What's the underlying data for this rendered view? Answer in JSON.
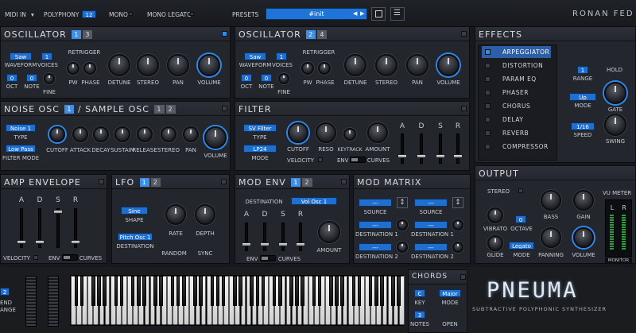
{
  "topbar": {
    "midi_in": "MIDI IN",
    "polyphony_label": "POLYPHONY",
    "polyphony_value": "12",
    "mono": "MONO",
    "mono_legato": "MONO LEGATO",
    "presets_label": "PRESETS",
    "preset_name": "#init",
    "brand": "RONAN FED"
  },
  "osc1": {
    "title": "OSCILLATOR",
    "tab_a": "1",
    "tab_b": "3",
    "waveform_value": "Saw",
    "waveform": "WAVEFORM",
    "voices_value": "1",
    "voices": "VOICES",
    "oct_value": "0",
    "oct": "OCT",
    "note_value": "0",
    "note": "NOTE",
    "fine": "FINE",
    "retrigger": "RETRIGGER",
    "pw": "PW",
    "phase": "PHASE",
    "detune": "DETUNE",
    "stereo": "STEREO",
    "pan": "PAN",
    "volume": "VOLUME"
  },
  "osc2": {
    "title": "OSCILLATOR",
    "tab_a": "2",
    "tab_b": "4",
    "waveform_value": "Saw",
    "waveform": "WAVEFORM",
    "voices_value": "1",
    "voices": "VOICES",
    "oct_value": "0",
    "oct": "OCT",
    "note_value": "0",
    "note": "NOTE",
    "fine": "FINE",
    "retrigger": "RETRIGGER",
    "pw": "PW",
    "phase": "PHASE",
    "detune": "DETUNE",
    "stereo": "STEREO",
    "pan": "PAN",
    "volume": "VOLUME"
  },
  "noise": {
    "title_a": "NOISE OSC",
    "tab_a": "1",
    "title_b": "/ SAMPLE OSC",
    "tab_b1": "1",
    "tab_b2": "2",
    "type_value": "Noise 1",
    "type": "TYPE",
    "filter_value": "Low Pass",
    "filter_mode": "FILTER MODE",
    "cutoff": "CUTOFF",
    "attack": "ATTACK",
    "decay": "DECAY",
    "sustain": "SUSTAIN",
    "release": "RELEASE",
    "stereo": "STEREO",
    "pan": "PAN",
    "volume": "VOLUME"
  },
  "filter": {
    "title": "FILTER",
    "type_value": "SV Filter",
    "type": "TYPE",
    "mode_value": "LP24",
    "mode": "MODE",
    "cutoff": "CUTOFF",
    "reso": "RESO",
    "keytrack": "KEYTRACK",
    "amount": "AMOUNT",
    "velocity": "VELOCITY",
    "env": "ENV",
    "curves": "CURVES",
    "adsr": [
      "A",
      "D",
      "S",
      "R"
    ]
  },
  "effects": {
    "title": "EFFECTS",
    "items": [
      "ARPEGGIATOR",
      "DISTORTION",
      "PARAM EQ",
      "PHASER",
      "CHORUS",
      "DELAY",
      "REVERB",
      "COMPRESSOR"
    ],
    "range_value": "1",
    "range": "RANGE",
    "hold": "HOLD",
    "mode_value": "Up",
    "mode": "MODE",
    "gate": "GATE",
    "speed_value": "1/16",
    "speed": "SPEED",
    "swing": "SWING"
  },
  "ampenv": {
    "title": "AMP ENVELOPE",
    "adsr": [
      "A",
      "D",
      "S",
      "R"
    ],
    "velocity": "VELOCITY",
    "env": "ENV",
    "curves": "CURVES"
  },
  "lfo": {
    "title": "LFO",
    "tab_a": "1",
    "tab_b": "2",
    "shape_value": "Sine",
    "shape": "SHAPE",
    "dest_value": "Pitch Osc 1",
    "destination": "DESTINATION",
    "rate": "RATE",
    "depth": "DEPTH",
    "random": "RANDOM",
    "sync": "SYNC"
  },
  "modenv": {
    "title": "MOD ENV",
    "tab_a": "1",
    "tab_b": "2",
    "destination_label": "DESTINATION",
    "dest_value": "Vol Osc 1",
    "adsr": [
      "A",
      "D",
      "S",
      "R"
    ],
    "amount": "AMOUNT",
    "env": "ENV",
    "curves": "CURVES"
  },
  "modmatrix": {
    "title": "MOD MATRIX",
    "source": "SOURCE",
    "destination1": "DESTINATION 1",
    "destination2": "DESTINATION 2",
    "empty": "---"
  },
  "output": {
    "title": "OUTPUT",
    "stereo": "STEREO",
    "vu": "VU METER",
    "vibrato": "VIBRATO",
    "octave_value": "0",
    "octave": "OCTAVE",
    "bass": "BASS",
    "gain": "GAIN",
    "glide": "GLIDE",
    "mode_value": "Legato",
    "mode": "MODE",
    "panning": "PANNING",
    "volume": "VOLUME",
    "l": "L",
    "r": "R",
    "monitor": "MONITOR"
  },
  "keyboard": {
    "bend_value": "2",
    "bend_a": "END",
    "bend_b": "ANGE"
  },
  "chords": {
    "title": "CHORDS",
    "key_value": "C",
    "key": "KEY",
    "mode_value": "Major",
    "mode": "MODE",
    "notes_value": "3",
    "notes": "NOTES",
    "open": "OPEN"
  },
  "logo": {
    "name": "PNEUMA",
    "subtitle": "SUBTRACTIVE POLYPHONIC SYNTHESIZER"
  }
}
